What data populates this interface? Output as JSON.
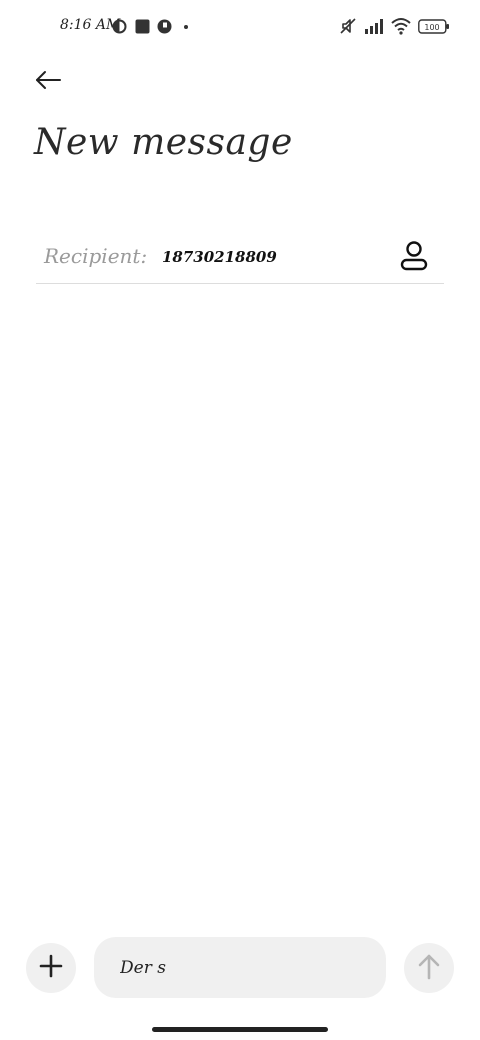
{
  "status_bar": {
    "time": "8:16 AM",
    "battery": "100",
    "left_icons": [
      "app-notification-icon",
      "stop-square-icon",
      "app-notification-icon",
      "dot-icon"
    ],
    "right_icons": [
      "muted-icon",
      "signal-icon",
      "wifi-icon",
      "battery-icon"
    ]
  },
  "header": {
    "back_icon": "arrow-left-icon",
    "title": "New message"
  },
  "recipient": {
    "label": "Recipient:",
    "value": "18730218809",
    "contact_icon": "person-icon"
  },
  "composer": {
    "add_icon": "plus-icon",
    "message_value": "Der s",
    "send_icon": "arrow-up-icon"
  },
  "colors": {
    "background": "#ffffff",
    "composer_bg": "#f0f0f0",
    "divider": "#dddddd",
    "label_gray": "#9a9a9a",
    "send_disabled": "#b5b5b5"
  }
}
